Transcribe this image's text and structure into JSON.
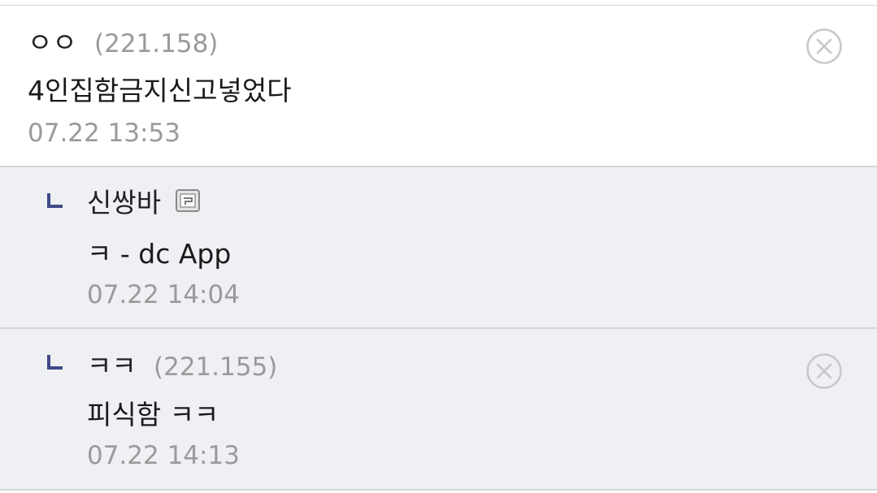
{
  "comments": [
    {
      "nickname": "ㅇㅇ",
      "ip": "(221.158)",
      "text": "4인집함금지신고넣었다",
      "date": "07.22 13:53",
      "deletable": true
    },
    {
      "nickname": "신쌍바",
      "ip": "",
      "text": "ㅋ - dc App",
      "date": "07.22 14:04",
      "deletable": false,
      "is_reply": true,
      "user_icon": "gallog-icon"
    },
    {
      "nickname": "ㅋㅋ",
      "ip": "(221.155)",
      "text": "피식함 ㅋㅋ",
      "date": "07.22 14:13",
      "deletable": true,
      "is_reply": true
    }
  ],
  "colors": {
    "reply_bg": "#eff0f4",
    "reply_arrow": "#3f4a86",
    "meta_gray": "#9a9a9a",
    "separator": "#d6d7dc"
  }
}
